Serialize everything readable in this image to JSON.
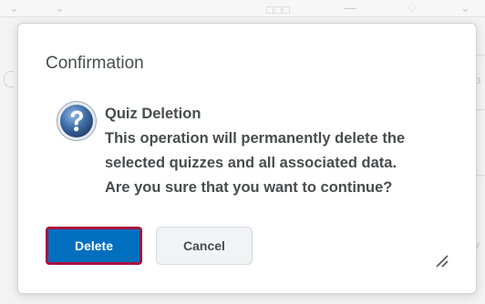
{
  "dialog": {
    "title": "Confirmation",
    "message": {
      "heading": "Quiz Deletion",
      "lines": [
        "This operation will permanently delete the",
        "selected quizzes and all associated data.",
        "Are you sure that you want to continue?"
      ]
    },
    "icon": "question-icon",
    "buttons": {
      "delete_label": "Delete",
      "cancel_label": "Cancel"
    },
    "resize_icon": "resize-handle-icon"
  },
  "colors": {
    "primary_button": "#006fbf",
    "focus_outline": "#a8123e",
    "text": "#494c4e",
    "icon_blue": "#3f6fa8"
  }
}
